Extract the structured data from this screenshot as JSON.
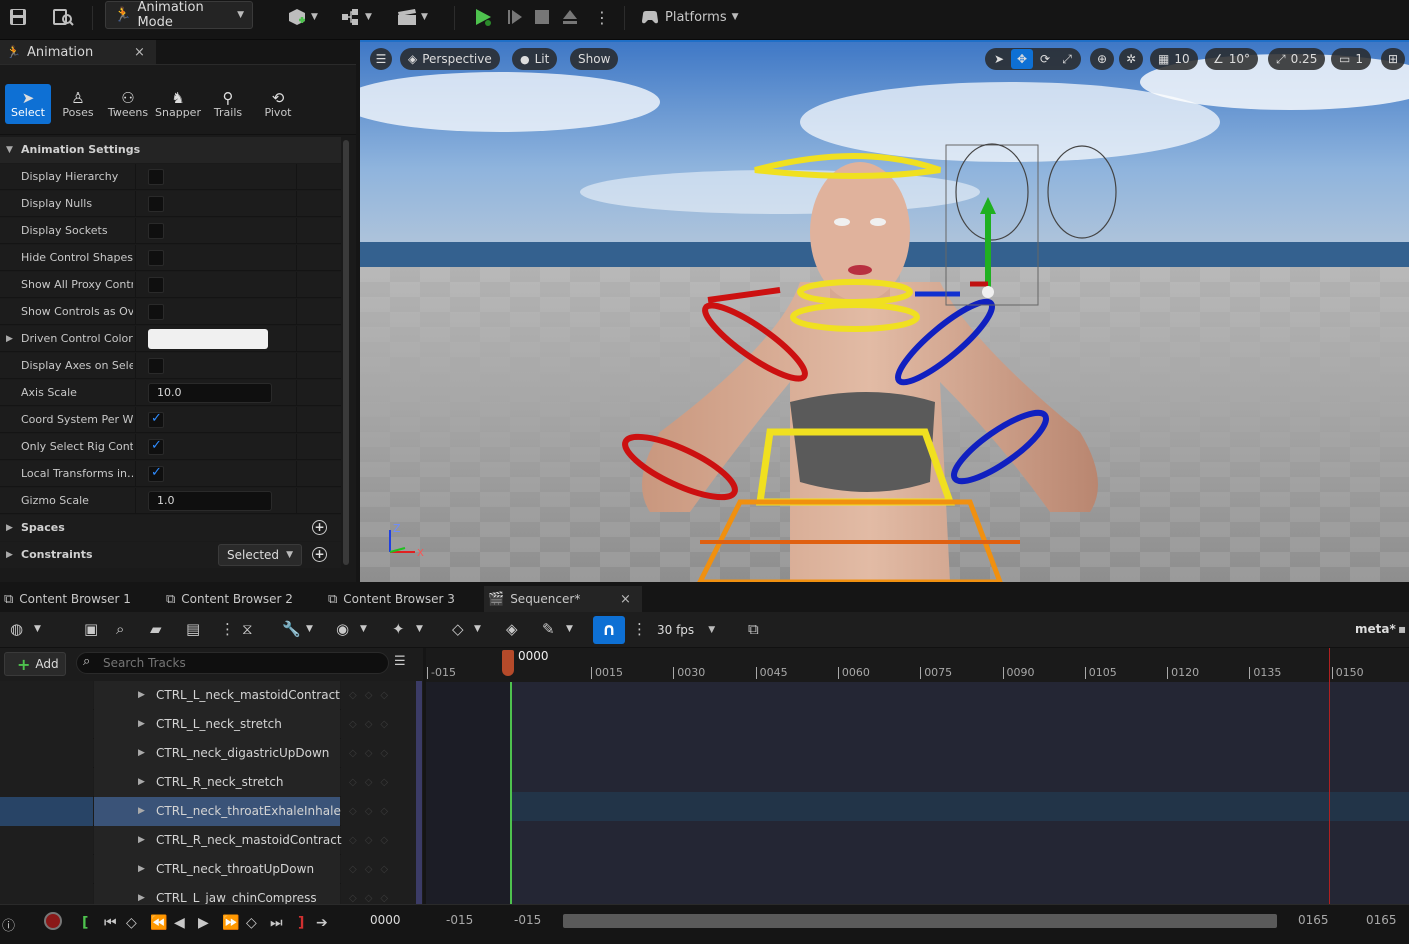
{
  "toolbar": {
    "mode_label": "Animation Mode",
    "platforms_label": "Platforms",
    "colors": {
      "play_green": "#4ec24e"
    }
  },
  "left_panel": {
    "tab_title": "Animation",
    "modes": [
      {
        "label": "Select",
        "icon": "select-cursor-icon",
        "active": true
      },
      {
        "label": "Poses",
        "icon": "poses-icon",
        "active": false
      },
      {
        "label": "Tweens",
        "icon": "tweens-icon",
        "active": false
      },
      {
        "label": "Snapper",
        "icon": "snapper-icon",
        "active": false
      },
      {
        "label": "Trails",
        "icon": "trails-icon",
        "active": false
      },
      {
        "label": "Pivot",
        "icon": "pivot-icon",
        "active": false
      }
    ],
    "section_title": "Animation Settings",
    "rows": [
      {
        "label": "Display Hierarchy",
        "type": "checkbox",
        "checked": false
      },
      {
        "label": "Display Nulls",
        "type": "checkbox",
        "checked": false
      },
      {
        "label": "Display Sockets",
        "type": "checkbox",
        "checked": false
      },
      {
        "label": "Hide Control Shapes",
        "type": "checkbox",
        "checked": false
      },
      {
        "label": "Show All Proxy Contr…",
        "type": "checkbox",
        "checked": false
      },
      {
        "label": "Show Controls as Ov…",
        "type": "checkbox",
        "checked": false
      },
      {
        "label": "Driven Control Color",
        "type": "color",
        "value": "#f0f0f0"
      },
      {
        "label": "Display Axes on Sele…",
        "type": "checkbox",
        "checked": false
      },
      {
        "label": "Axis Scale",
        "type": "number",
        "value": "10.0"
      },
      {
        "label": "Coord System Per Wi…",
        "type": "checkbox",
        "checked": true
      },
      {
        "label": "Only Select Rig Cont…",
        "type": "checkbox",
        "checked": true
      },
      {
        "label": "Local Transforms in…",
        "type": "checkbox",
        "checked": true
      },
      {
        "label": "Gizmo Scale",
        "type": "number",
        "value": "1.0"
      }
    ],
    "spaces_label": "Spaces",
    "constraints_label": "Constraints",
    "constraints_dropdown": "Selected"
  },
  "viewport": {
    "perspective_label": "Perspective",
    "lit_label": "Lit",
    "show_label": "Show",
    "grid_snap": "10",
    "rot_snap": "10°",
    "scale_snap": "0.25",
    "camera_speed": "1"
  },
  "bottom_tabs": [
    {
      "label": "Content Browser 1",
      "active": false
    },
    {
      "label": "Content Browser 2",
      "active": false
    },
    {
      "label": "Content Browser 3",
      "active": false
    },
    {
      "label": "Sequencer*",
      "active": true
    }
  ],
  "sequencer": {
    "fps_label": "30 fps",
    "asset_label": "meta*",
    "add_label": "Add",
    "search_placeholder": "Search Tracks",
    "current_frame": "0000",
    "ruler_ticks": [
      "-015",
      "0015",
      "0030",
      "0045",
      "0060",
      "0075",
      "0090",
      "0105",
      "0120",
      "0135",
      "0150"
    ],
    "tracks": [
      {
        "name": "CTRL_L_neck_mastoidContract",
        "selected": false
      },
      {
        "name": "CTRL_L_neck_stretch",
        "selected": false
      },
      {
        "name": "CTRL_neck_digastricUpDown",
        "selected": false
      },
      {
        "name": "CTRL_R_neck_stretch",
        "selected": false
      },
      {
        "name": "CTRL_neck_throatExhaleInhale",
        "selected": true
      },
      {
        "name": "CTRL_R_neck_mastoidContract",
        "selected": false
      },
      {
        "name": "CTRL_neck_throatUpDown",
        "selected": false
      },
      {
        "name": "CTRL_L_jaw_chinCompress",
        "selected": false
      }
    ],
    "playback": {
      "frame": "0000",
      "view_start": "-015",
      "work_start": "-015",
      "work_end": "0165",
      "view_end": "0165"
    }
  }
}
